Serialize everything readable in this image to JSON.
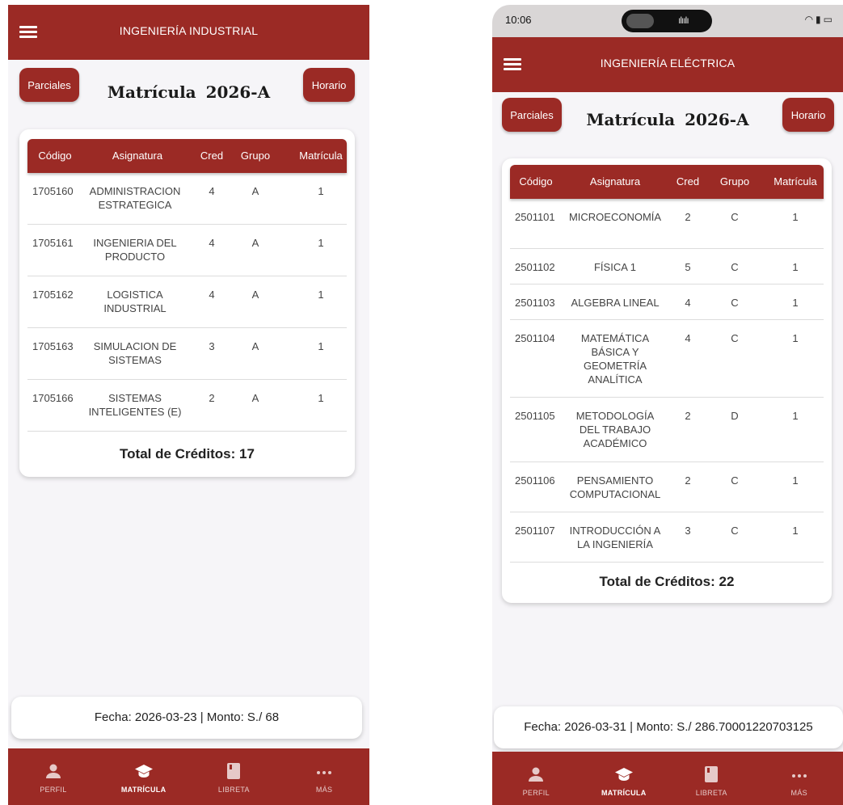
{
  "colors": {
    "primary": "#9b2a25",
    "background": "#f6f5f8",
    "card": "#ffffff"
  },
  "left": {
    "header_title": "INGENIERÍA INDUSTRIAL",
    "parciales_label": "Parciales",
    "horario_label": "Horario",
    "matricula_label": "Matrícula",
    "term": "2026-A",
    "columns": [
      "Código",
      "Asignatura",
      "Cred",
      "Grupo",
      "Matrícula"
    ],
    "rows": [
      {
        "codigo": "1705160",
        "asignatura": "ADMINISTRACION ESTRATEGICA",
        "cred": "4",
        "grupo": "A",
        "matricula": "1"
      },
      {
        "codigo": "1705161",
        "asignatura": "INGENIERIA DEL PRODUCTO",
        "cred": "4",
        "grupo": "A",
        "matricula": "1"
      },
      {
        "codigo": "1705162",
        "asignatura": "LOGISTICA INDUSTRIAL",
        "cred": "4",
        "grupo": "A",
        "matricula": "1"
      },
      {
        "codigo": "1705163",
        "asignatura": "SIMULACION DE SISTEMAS",
        "cred": "3",
        "grupo": "A",
        "matricula": "1"
      },
      {
        "codigo": "1705166",
        "asignatura": "SISTEMAS INTELIGENTES (E)",
        "cred": "2",
        "grupo": "A",
        "matricula": "1"
      }
    ],
    "total_text": "Total de Créditos: 17",
    "footer_text": "Fecha: 2026-03-23 | Monto: S./ 68",
    "nav": [
      "PERFIL",
      "MATRÍCULA",
      "LIBRETA",
      "MÁS"
    ]
  },
  "right": {
    "status_time": "10:06",
    "header_title": "INGENIERÍA ELÉCTRICA",
    "parciales_label": "Parciales",
    "horario_label": "Horario",
    "matricula_label": "Matrícula",
    "term": "2026-A",
    "columns": [
      "Código",
      "Asignatura",
      "Cred",
      "Grupo",
      "Matrícula"
    ],
    "rows": [
      {
        "codigo": "2501101",
        "asignatura": "MICROECONOMÍA",
        "cred": "2",
        "grupo": "C",
        "matricula": "1"
      },
      {
        "codigo": "2501102",
        "asignatura": "FÍSICA 1",
        "cred": "5",
        "grupo": "C",
        "matricula": "1"
      },
      {
        "codigo": "2501103",
        "asignatura": "ALGEBRA LINEAL",
        "cred": "4",
        "grupo": "C",
        "matricula": "1"
      },
      {
        "codigo": "2501104",
        "asignatura": "MATEMÁTICA BÁSICA Y GEOMETRÍA ANALÍTICA",
        "cred": "4",
        "grupo": "C",
        "matricula": "1"
      },
      {
        "codigo": "2501105",
        "asignatura": "METODOLOGÍA DEL TRABAJO ACADÉMICO",
        "cred": "2",
        "grupo": "D",
        "matricula": "1"
      },
      {
        "codigo": "2501106",
        "asignatura": "PENSAMIENTO COMPUTACIONAL",
        "cred": "2",
        "grupo": "C",
        "matricula": "1"
      },
      {
        "codigo": "2501107",
        "asignatura": "INTRODUCCIÓN A LA INGENIERÍA",
        "cred": "3",
        "grupo": "C",
        "matricula": "1"
      }
    ],
    "total_text": "Total de Créditos: 22",
    "footer_text": "Fecha: 2026-03-31 | Monto: S./ 286.70001220703125",
    "nav": [
      "PERFIL",
      "MATRÍCULA",
      "LIBRETA",
      "MÁS"
    ]
  }
}
